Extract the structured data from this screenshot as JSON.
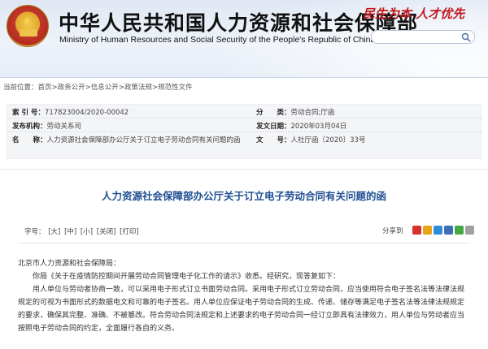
{
  "header": {
    "title": "中华人民共和国人力资源和社会保障部",
    "subtitle": "Ministry of Human Resources and Social Security of the People's Republic of China",
    "slogan": "民生为本 人才优先",
    "search": {
      "placeholder": "",
      "icon": "search-icon"
    }
  },
  "breadcrumb": {
    "prefix": "当前位置：",
    "items": [
      "首页",
      "政务公开",
      "信息公开",
      "政策法规",
      "规范性文件"
    ],
    "sep": ">"
  },
  "meta": {
    "index_no": {
      "label": "索 引 号：",
      "value": "717823004/2020-00042"
    },
    "category": {
      "label": "分　　类：",
      "value": "劳动合同;厅函"
    },
    "issuer": {
      "label": "发布机构：",
      "value": "劳动关系司"
    },
    "date": {
      "label": "发文日期：",
      "value": "2020年03月04日"
    },
    "name": {
      "label": "名　　称：",
      "value": "人力资源社会保障部办公厅关于订立电子劳动合同有关问题的函"
    },
    "doc_no": {
      "label": "文　　号：",
      "value": "人社厅函〔2020〕33号"
    }
  },
  "article": {
    "title": "人力资源社会保障部办公厅关于订立电子劳动合同有关问题的函",
    "font_label": "字号：",
    "font_sizes": [
      "[大]",
      "[中]",
      "[小]"
    ],
    "close_label": "[关闭]",
    "print_label": "[打印]",
    "share_label": "分享到",
    "share_colors": [
      "#d6322f",
      "#e8a317",
      "#2f8cd8",
      "#3e6fb3",
      "#44a843",
      "#a0a0a0"
    ],
    "salutation": "北京市人力资源和社会保障局：",
    "paragraphs": [
      "你局《关于在疫情防控期间开展劳动合同管理电子化工作的请示》收悉。经研究，现答复如下：",
      "用人单位与劳动者协商一致，可以采用电子形式订立书面劳动合同。采用电子形式订立劳动合同，应当使用符合电子签名法等法律法规规定的可视为书面形式的数据电文和可靠的电子签名。用人单位应保证电子劳动合同的生成、传递、储存等满足电子签名法等法律法规规定的要求，确保其完整、准确、不被篡改。符合劳动合同法规定和上述要求的电子劳动合同一经订立即具有法律效力，用人单位与劳动者应当按照电子劳动合同的约定，全面履行各自的义务。"
    ]
  }
}
